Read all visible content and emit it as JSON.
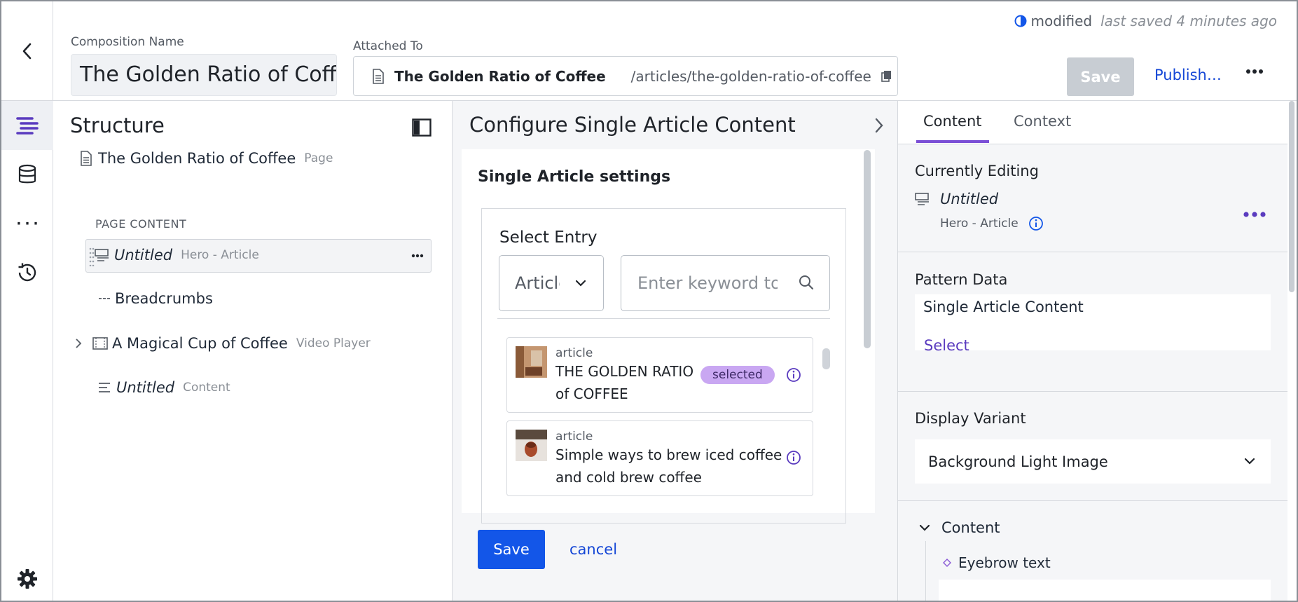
{
  "header": {
    "composition_label": "Composition Name",
    "composition_value": "The Golden Ratio of Coffee",
    "attached_label": "Attached To",
    "attached_title": "The Golden Ratio of Coffee",
    "attached_path": "/articles/the-golden-ratio-of-coffee",
    "status_text": "modified",
    "last_saved": "last saved 4 minutes ago",
    "save_label": "Save",
    "publish_label": "Publish…"
  },
  "rail": {
    "items": [
      "structure",
      "data",
      "parameters",
      "history"
    ],
    "bottom": "settings"
  },
  "structure": {
    "title": "Structure",
    "page_title": "The Golden Ratio of Coffee",
    "page_type": "Page",
    "section_label": "PAGE CONTENT",
    "items": [
      {
        "name": "Untitled",
        "type": "Hero - Article"
      },
      {
        "name": "Breadcrumbs",
        "type": ""
      },
      {
        "name": "A Magical Cup of Coffee",
        "type": "Video Player"
      },
      {
        "name": "Untitled",
        "type": "Content"
      }
    ]
  },
  "config": {
    "title": "Configure Single Article Content",
    "card_title": "Single Article settings",
    "select_entry_label": "Select Entry",
    "type_value": "Article",
    "keyword_placeholder": "Enter keyword to narrow",
    "results": [
      {
        "kind": "article",
        "title": "THE GOLDEN RATIO of COFFEE",
        "badge": "selected"
      },
      {
        "kind": "article",
        "title": "Simple ways to brew iced coffee and cold brew coffee",
        "badge": ""
      }
    ],
    "save_label": "Save",
    "cancel_label": "cancel"
  },
  "right": {
    "tabs": [
      "Content",
      "Context"
    ],
    "currently_editing_label": "Currently Editing",
    "editing_name": "Untitled",
    "editing_type": "Hero - Article",
    "pattern_data_label": "Pattern Data",
    "pattern_data_value": "Single Article Content",
    "select_label": "Select",
    "display_variant_label": "Display Variant",
    "display_variant_value": "Background Light Image",
    "content_group_label": "Content",
    "eyebrow_label": "Eyebrow text"
  },
  "colors": {
    "accent_purple": "#7b4fd6",
    "primary_blue": "#1356e8",
    "link_blue": "#1547d6",
    "selected_badge": "#c9a7f2"
  }
}
